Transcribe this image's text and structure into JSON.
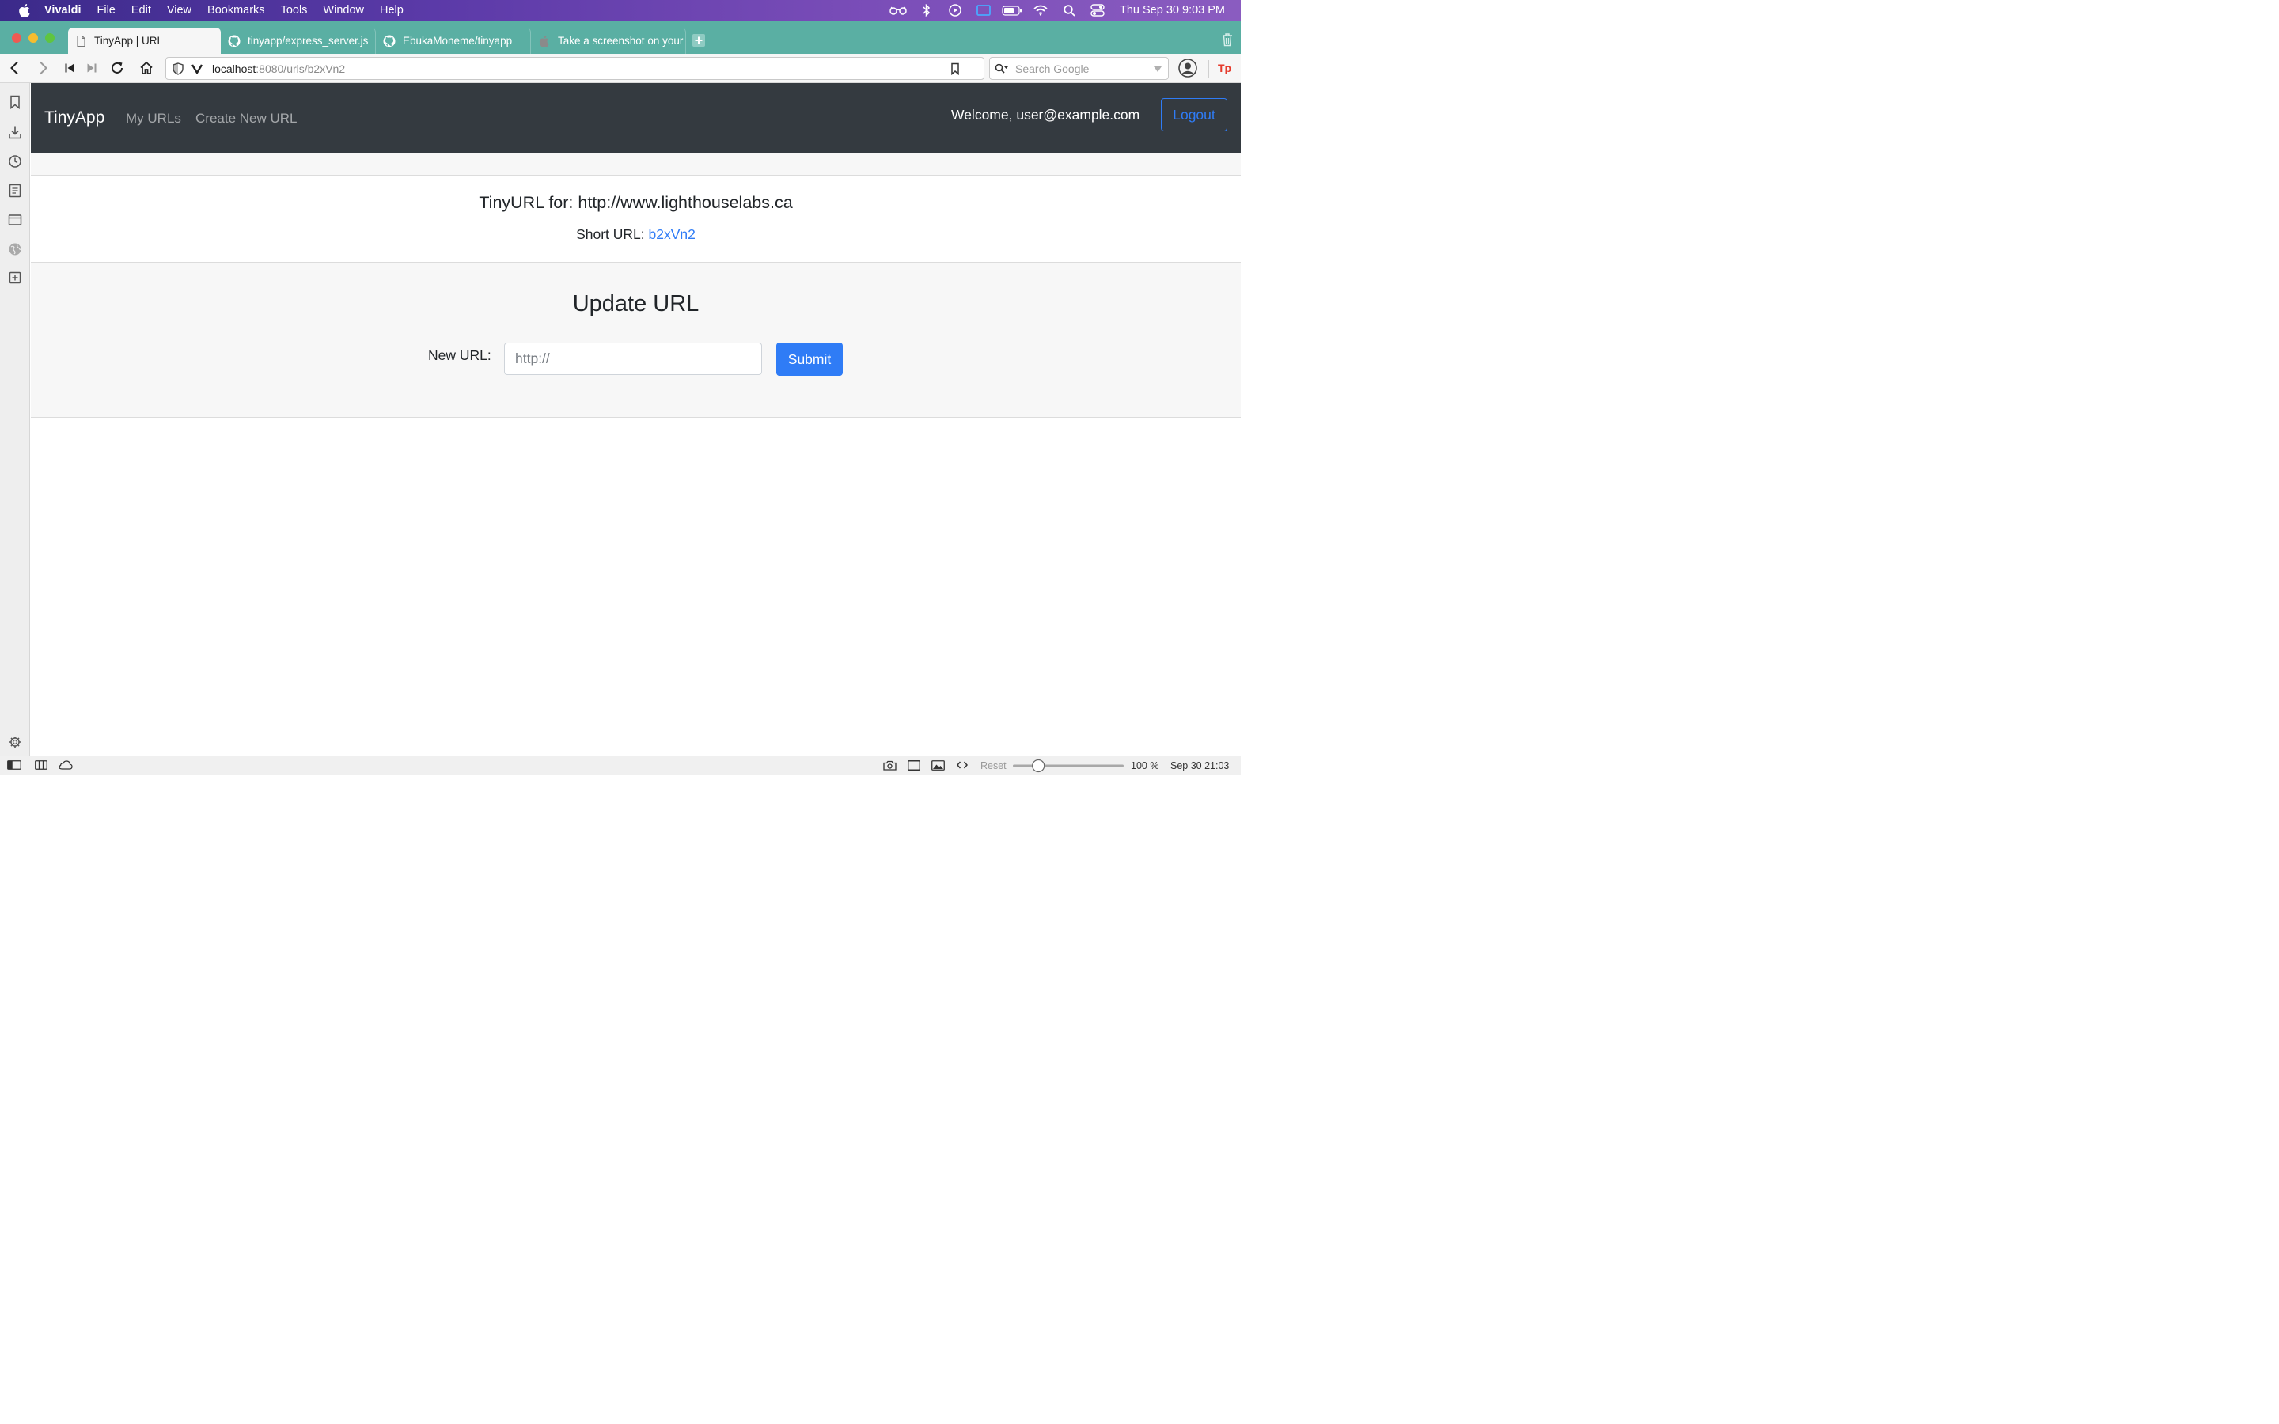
{
  "menubar": {
    "app_name": "Vivaldi",
    "items": [
      "File",
      "Edit",
      "View",
      "Bookmarks",
      "Tools",
      "Window",
      "Help"
    ],
    "clock": "Thu Sep 30  9:03 PM"
  },
  "tabs": [
    {
      "title": "TinyApp | URL",
      "icon": "page-icon",
      "active": true
    },
    {
      "title": "tinyapp/express_server.js",
      "icon": "github-icon",
      "active": false
    },
    {
      "title": "EbukaMoneme/tinyapp",
      "icon": "github-icon",
      "active": false
    },
    {
      "title": "Take a screenshot on your",
      "icon": "apple-icon",
      "active": false
    }
  ],
  "address": {
    "host": "localhost",
    "path": ":8080/urls/b2xVn2",
    "search_placeholder": "Search Google"
  },
  "app": {
    "brand": "TinyApp",
    "nav_links": [
      "My URLs",
      "Create New URL"
    ],
    "welcome": "Welcome, user@example.com",
    "logout_label": "Logout"
  },
  "detail": {
    "title": "TinyURL for: http://www.lighthouselabs.ca",
    "short_url_label": "Short URL:",
    "short_url_value": "b2xVn2"
  },
  "update": {
    "title": "Update URL",
    "field_label": "New URL:",
    "placeholder": "http://",
    "submit_label": "Submit"
  },
  "statusbar": {
    "reset_label": "Reset",
    "zoom": "100 %",
    "zoom_fraction": 0.2,
    "datetime": "Sep 30  21:03"
  },
  "colors": {
    "menubar": "#5b3aa8",
    "tabbar": "#5aafa3",
    "navbar": "#343a40",
    "primary": "#2f7cf6",
    "close": "#ee5a52",
    "minimize": "#f5bd2f",
    "maximize": "#5fc540"
  }
}
